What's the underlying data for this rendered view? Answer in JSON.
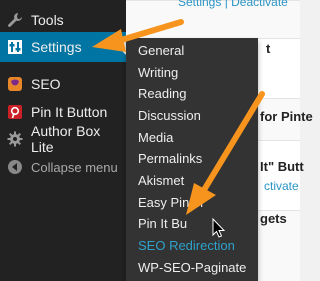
{
  "sidebar": {
    "items": [
      {
        "label": "Tools",
        "icon": "wrench-icon"
      },
      {
        "label": "Settings",
        "icon": "settings-icon",
        "active": true
      },
      {
        "label": "SEO",
        "icon": "seo-icon"
      },
      {
        "label": "Pin It Button",
        "icon": "pinterest-icon"
      },
      {
        "label": "Author Box Lite",
        "icon": "gear-icon"
      }
    ],
    "collapse_label": "Collapse menu"
  },
  "submenu": {
    "items": [
      "General",
      "Writing",
      "Reading",
      "Discussion",
      "Media",
      "Permalinks",
      "Akismet",
      "Easy Pinter",
      "Pin It Bu",
      "SEO Redirection",
      "WP-SEO-Paginate"
    ],
    "hovered": "SEO Redirection"
  },
  "content": {
    "row1_links": "Settings | Deactivate",
    "row2_text": "t",
    "row3_text": "for Pinte",
    "row4_text": "It\" Butt",
    "row4_link": "ctivate",
    "row5_text": "gets"
  },
  "colors": {
    "sidebar_bg": "#222222",
    "active_bg": "#0074a2",
    "flyout_bg": "#333333",
    "hover_text": "#2ea2cc",
    "arrow": "#f7941d"
  }
}
